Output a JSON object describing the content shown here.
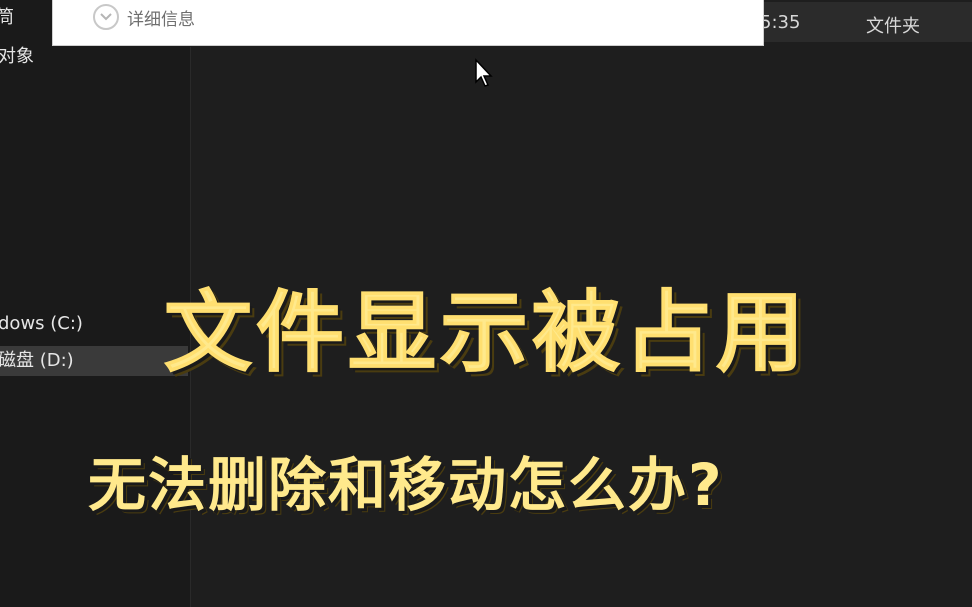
{
  "sidebar": {
    "items": [
      {
        "label": "筒"
      },
      {
        "label": "对象"
      },
      {
        "label": "dows (C:)"
      },
      {
        "label": "磁盘 (D:)"
      }
    ]
  },
  "details_pane": {
    "toggle_label": "详细信息"
  },
  "file_row": {
    "time_fragment": "5:35",
    "type": "文件夹"
  },
  "overlay": {
    "headline": "文件显示被占用",
    "subline": "无法删除和移动怎么办?"
  },
  "colors": {
    "accent": "#ffe98c",
    "background": "#1e1e1e"
  },
  "icons": [
    "chevron-down-icon",
    "cursor-icon"
  ]
}
